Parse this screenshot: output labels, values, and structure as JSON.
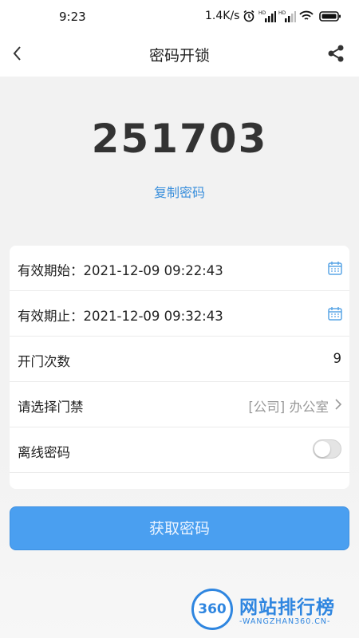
{
  "status_bar": {
    "time": "9:23",
    "network_speed": "1.4K/s"
  },
  "header": {
    "title": "密码开锁"
  },
  "password": {
    "code": "251703",
    "copy_label": "复制密码"
  },
  "form": {
    "rows": [
      {
        "label": "有效期始：",
        "value": "2021-12-09 09:22:43"
      },
      {
        "label": "有效期止：",
        "value": "2021-12-09 09:32:43"
      },
      {
        "label": "开门次数",
        "value": "9"
      },
      {
        "label": "请选择门禁",
        "value": "[公司] 办公室"
      },
      {
        "label": "离线密码",
        "toggle_on": false
      }
    ]
  },
  "actions": {
    "get_password_label": "获取密码"
  },
  "watermark": {
    "logo_text": "360",
    "title": "网站排行榜",
    "subtitle": "-WANGZHAN360.CN-"
  },
  "colors": {
    "accent": "#4a9ff0",
    "link": "#3a8fdc"
  },
  "icons": [
    "alarm-icon",
    "signal-hd-icon",
    "wifi-icon",
    "battery-icon",
    "back-chevron-icon",
    "share-icon",
    "calendar-icon",
    "chevron-right-icon"
  ]
}
